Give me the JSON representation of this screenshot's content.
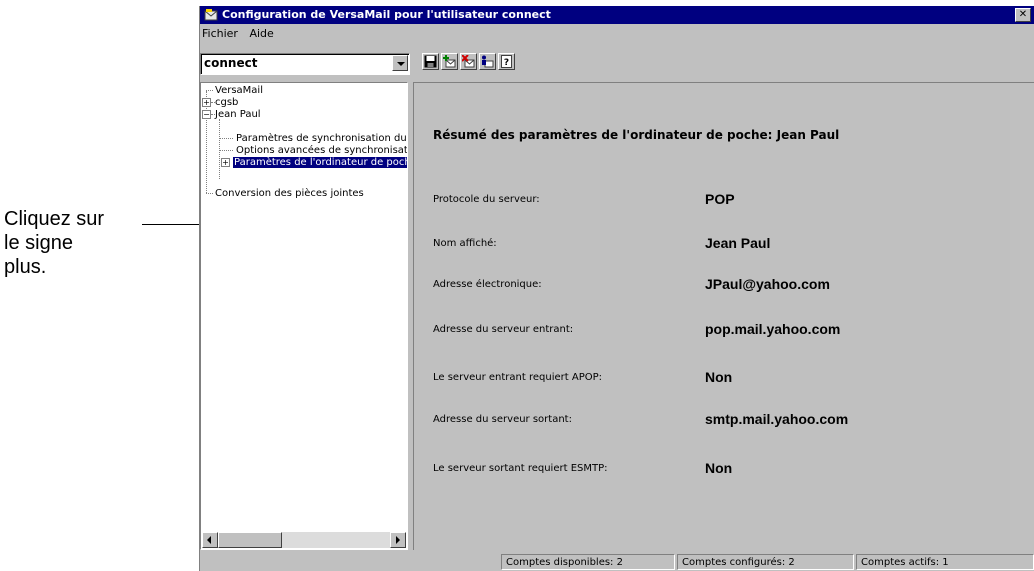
{
  "callout": {
    "line1": "Cliquez sur",
    "line2": "le signe",
    "line3": "plus."
  },
  "window": {
    "title": "Configuration de VersaMail pour l'utilisateur connect",
    "close_glyph": "✕"
  },
  "menu": {
    "file": "Fichier",
    "help": "Aide"
  },
  "account_select": {
    "value": "connect"
  },
  "toolbar": {
    "icons": [
      "save-icon",
      "add-mail-icon",
      "delete-mail-icon",
      "user-mail-icon",
      "help-icon"
    ]
  },
  "tree": {
    "items": [
      {
        "label": "VersaMail"
      },
      {
        "label": "cgsb"
      },
      {
        "label": "Jean Paul"
      },
      {
        "label": "Paramètres de synchronisation du"
      },
      {
        "label": "Options avancées de synchronisation"
      },
      {
        "label": "Paramètres de l'ordinateur de poche"
      },
      {
        "label": "Conversion des pièces jointes"
      }
    ]
  },
  "summary": {
    "title": "Résumé des paramètres de l'ordinateur de poche: Jean Paul",
    "fields": [
      {
        "label": "Protocole du serveur:",
        "value": "POP"
      },
      {
        "label": "Nom affiché:",
        "value": "Jean Paul"
      },
      {
        "label": "Adresse électronique:",
        "value": "JPaul@yahoo.com"
      },
      {
        "label": "Adresse du serveur entrant:",
        "value": "pop.mail.yahoo.com"
      },
      {
        "label": "Le serveur entrant requiert APOP:",
        "value": "Non"
      },
      {
        "label": "Adresse du serveur sortant:",
        "value": "smtp.mail.yahoo.com"
      },
      {
        "label": "Le serveur sortant requiert ESMTP:",
        "value": "Non"
      }
    ]
  },
  "status": {
    "available": "Comptes disponibles: 2",
    "configured": "Comptes configurés: 2",
    "active": "Comptes actifs: 1"
  },
  "colors": {
    "titlebar": "#000080",
    "face": "#c0c0c0",
    "selection": "#000080"
  }
}
